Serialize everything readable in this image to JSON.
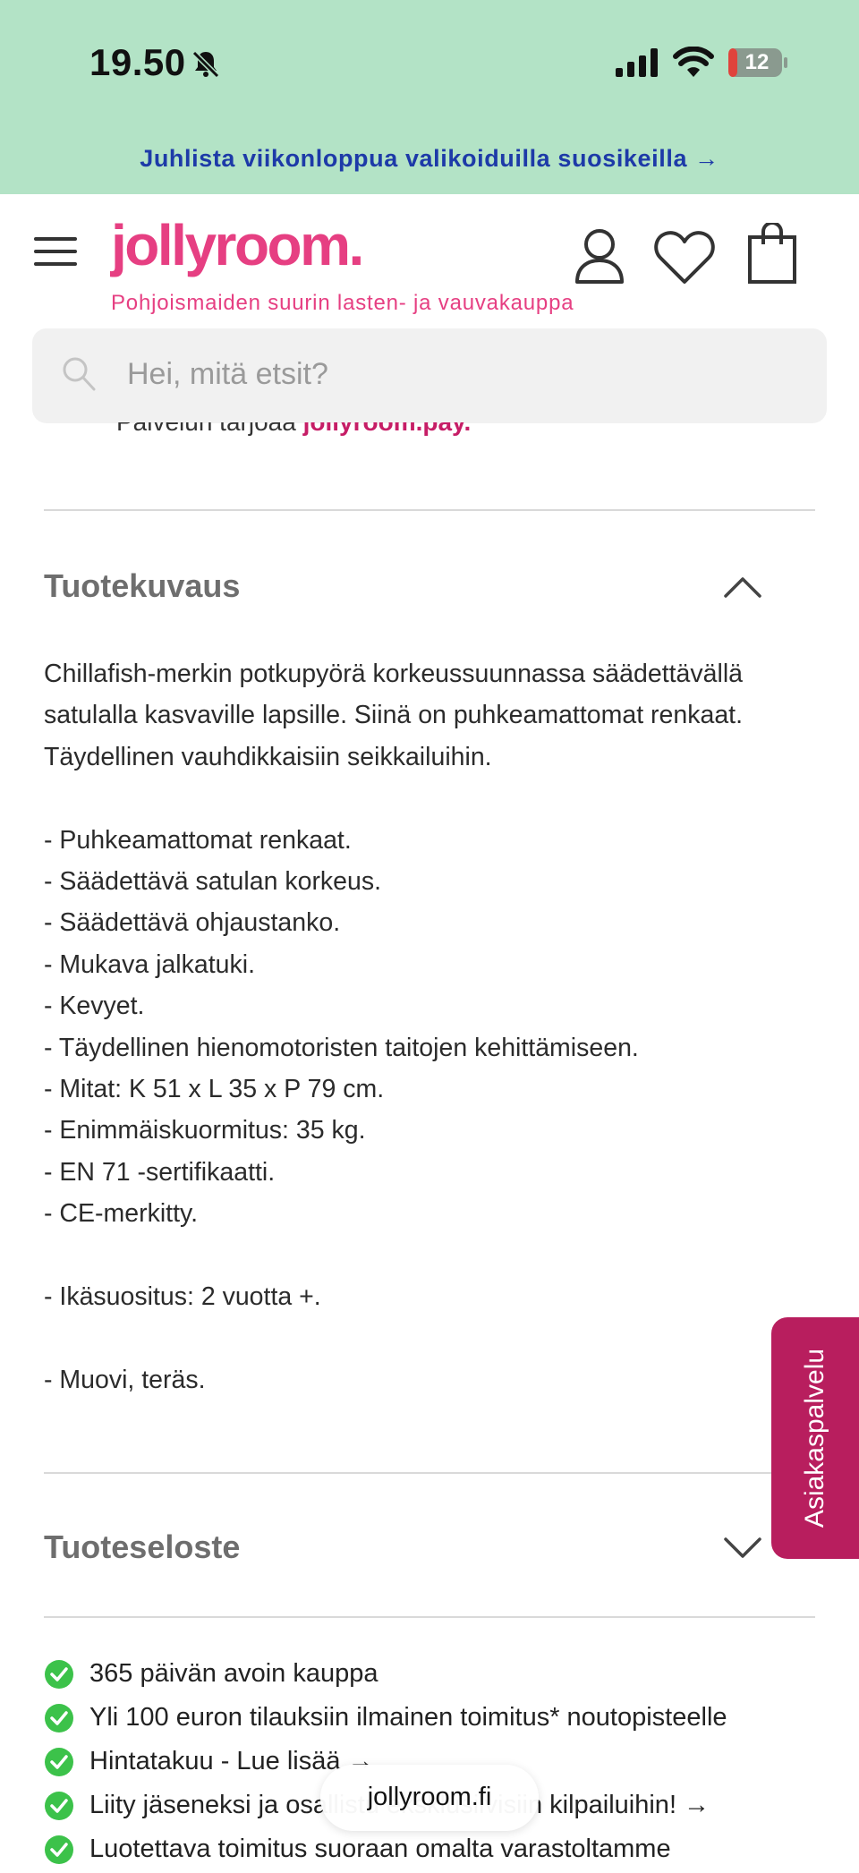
{
  "status_bar": {
    "time": "19.50",
    "battery": "12"
  },
  "promo": {
    "text": "Juhlista viikonloppua valikoiduilla suosikeilla →"
  },
  "header": {
    "logo": "jollyroom.",
    "tagline": "Pohjoismaiden suurin lasten- ja vauvakauppa"
  },
  "search": {
    "placeholder": "Hei, mitä etsit?"
  },
  "partial": {
    "prefix": "Palvelun tarjoaa ",
    "brand": "jollyroom.pay."
  },
  "description": {
    "title": "Tuotekuvaus",
    "intro": "Chillafish-merkin potkupyörä korkeussuunnassa säädettävällä satulalla kasvaville lapsille. Siinä on puhkeamattomat renkaat. Täydellinen vauhdikkaisiin seikkailuihin.",
    "features": [
      "- Puhkeamattomat renkaat.",
      "- Säädettävä satulan korkeus.",
      "- Säädettävä ohjaustanko.",
      "- Mukava jalkatuki.",
      "- Kevyet.",
      "- Täydellinen hienomotoristen taitojen kehittämiseen.",
      "- Mitat: K 51 x L 35 x P 79 cm.",
      "- Enimmäiskuormitus: 35 kg.",
      "- EN 71 -sertifikaatti.",
      "- CE-merkitty."
    ],
    "age": "- Ikäsuositus: 2 vuotta +.",
    "material": "- Muovi, teräs."
  },
  "specs": {
    "title": "Tuoteseloste"
  },
  "customer_service": {
    "label": "Asiakaspalvelu"
  },
  "usps": [
    "365 päivän avoin kauppa",
    "Yli 100 euron tilauksiin ilmainen toimitus* noutopisteelle",
    "Hintatakuu - Lue lisää →",
    "Liity jäseneksi ja osallistu eksklusiivisiin kilpailuihin! →",
    "Luotettava toimitus suoraan omalta varastoltamme"
  ],
  "browser": {
    "url": "jollyroom.fi"
  },
  "colors": {
    "brand_pink": "#e63f82",
    "banner_green": "#b3e3c6",
    "tab_magenta": "#b81e5e",
    "check_green": "#3cc24a"
  }
}
